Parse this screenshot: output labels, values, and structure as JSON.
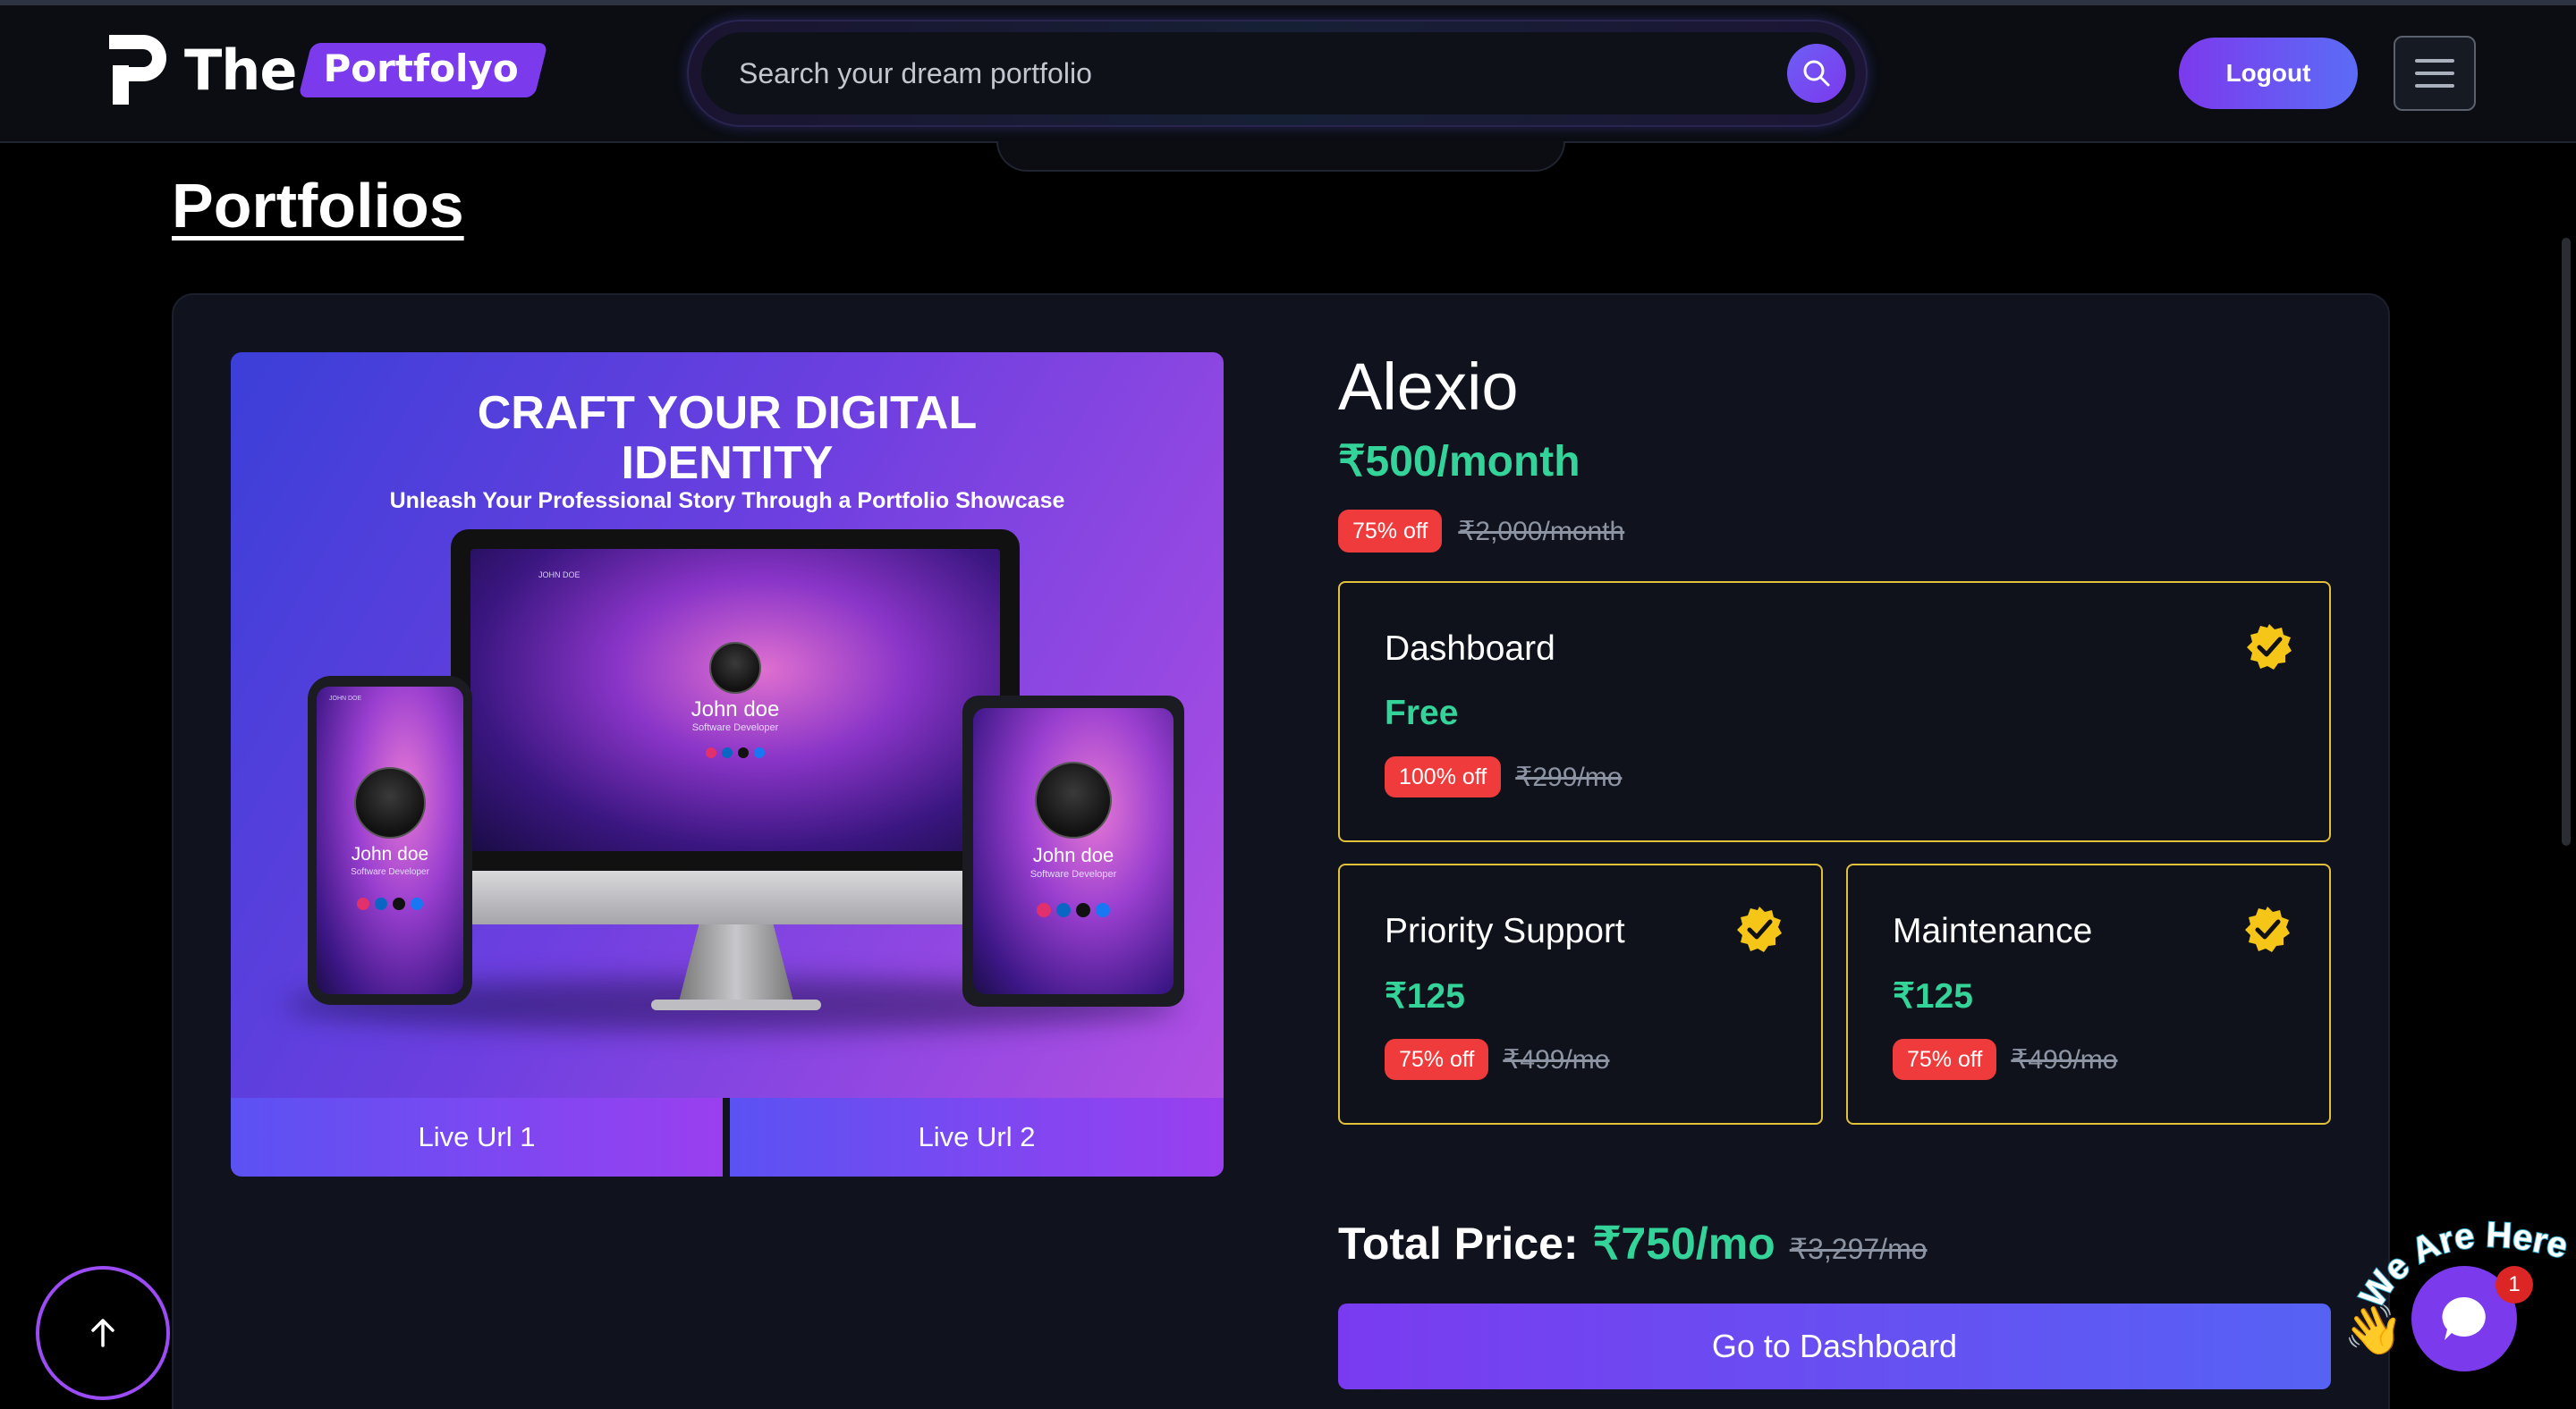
{
  "header": {
    "logo_word": "The",
    "logo_badge": "Portfolyo",
    "search_placeholder": "Search your dream portfolio",
    "logout_label": "Logout"
  },
  "page": {
    "title": "Portfolios"
  },
  "portfolio": {
    "preview": {
      "headline_line1": "CRAFT YOUR DIGITAL",
      "headline_line2": "IDENTITY",
      "subheadline": "Unleash Your Professional Story Through a Portfolio Showcase",
      "mock_name": "John doe",
      "mock_role": "Software Developer",
      "mock_nav": "JOHN DOE"
    },
    "live_url_1": "Live Url 1",
    "live_url_2": "Live Url 2",
    "name": "Alexio",
    "price": "₹500/month",
    "discount": "75% off",
    "original_price": "₹2,000/month",
    "features": [
      {
        "title": "Dashboard",
        "price": "Free",
        "discount": "100% off",
        "original_price": "₹299/mo"
      },
      {
        "title": "Priority Support",
        "price": "₹125",
        "discount": "75% off",
        "original_price": "₹499/mo"
      },
      {
        "title": "Maintenance",
        "price": "₹125",
        "discount": "75% off",
        "original_price": "₹499/mo"
      }
    ],
    "total_label": "Total Price:",
    "total_price": "₹750/mo",
    "total_original": "₹3,297/mo",
    "dashboard_button": "Go to Dashboard"
  },
  "chat_widget": {
    "tagline": "We Are Here!",
    "unread_count": "1"
  },
  "colors": {
    "accent": "#7c3aed",
    "price_green": "#34d399",
    "discount_red": "#ef3b3b",
    "feature_border": "#e1c03a"
  }
}
